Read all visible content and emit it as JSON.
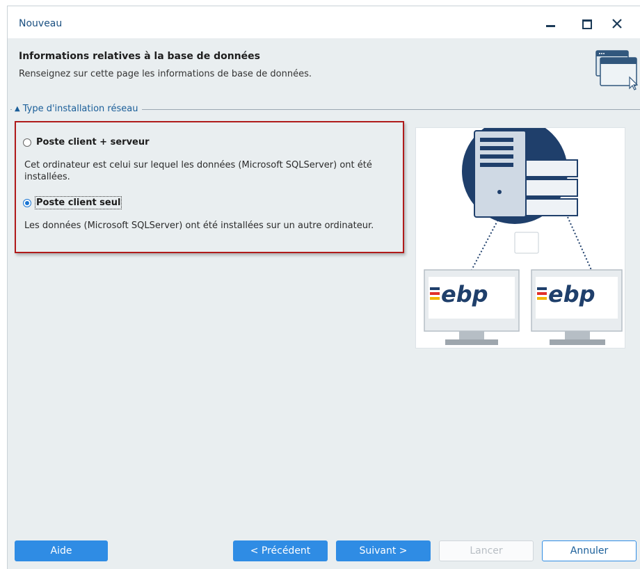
{
  "window": {
    "title": "Nouveau"
  },
  "header": {
    "title": "Informations relatives à la base de données",
    "subtitle": "Renseignez sur cette page les informations de base de données."
  },
  "section": {
    "label": "Type d'installation réseau"
  },
  "options": [
    {
      "label": "Poste client + serveur",
      "description": "Cet ordinateur est celui sur lequel les données (Microsoft SQLServer) ont été installées.",
      "checked": false
    },
    {
      "label": "Poste client seul",
      "description": "Les données (Microsoft SQLServer) ont été installées sur un autre ordinateur.",
      "checked": true
    }
  ],
  "illustration": {
    "brand_text": "ebp"
  },
  "buttons": {
    "help": "Aide",
    "previous": "< Précédent",
    "next": "Suivant >",
    "launch": "Lancer",
    "cancel": "Annuler"
  },
  "colors": {
    "accent": "#2f8ce4",
    "highlight_border": "#b01a1a",
    "server_navy": "#1f3f6b"
  }
}
